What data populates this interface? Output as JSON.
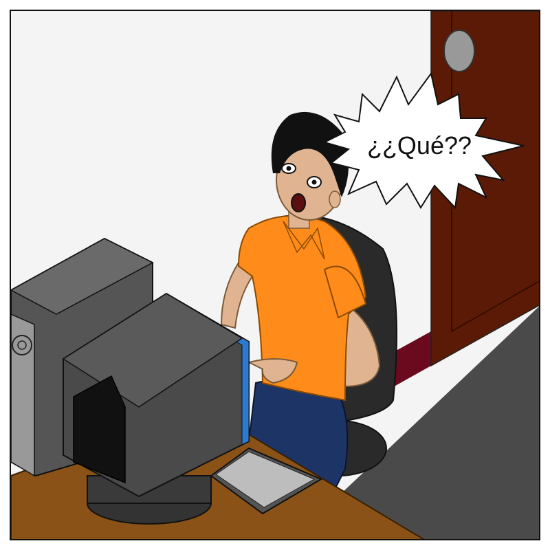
{
  "speech_bubble": {
    "text": "¿¿Qué??"
  },
  "colors": {
    "wall": "#f4f4f4",
    "door": "#5a1a05",
    "floor": "#4a4a4a",
    "carpet_edge": "#6b0a1e",
    "desk": "#8a5216",
    "shirt": "#ff8c1a",
    "jeans": "#1c3566",
    "skin": "#e0b491",
    "hair": "#111111",
    "monitor": "#4a4a4a",
    "chair": "#2a2a2a",
    "tower": "#555555"
  }
}
